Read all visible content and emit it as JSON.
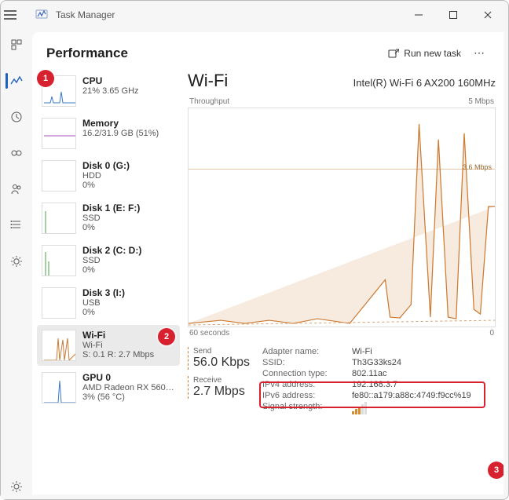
{
  "app": {
    "title": "Task Manager"
  },
  "header": {
    "pageTitle": "Performance",
    "runTask": "Run new task"
  },
  "sidebar": {
    "items": [
      {
        "title": "CPU",
        "line1": "21%  3.65 GHz",
        "line2": ""
      },
      {
        "title": "Memory",
        "line1": "16.2/31.9 GB (51%)",
        "line2": ""
      },
      {
        "title": "Disk 0 (G:)",
        "line1": "HDD",
        "line2": "0%"
      },
      {
        "title": "Disk 1 (E: F:)",
        "line1": "SSD",
        "line2": "0%"
      },
      {
        "title": "Disk 2 (C: D:)",
        "line1": "SSD",
        "line2": "0%"
      },
      {
        "title": "Disk 3 (I:)",
        "line1": "USB",
        "line2": "0%"
      },
      {
        "title": "Wi-Fi",
        "line1": "Wi-Fi",
        "line2": "S: 0.1 R: 2.7 Mbps"
      },
      {
        "title": "GPU 0",
        "line1": "AMD Radeon RX 560…",
        "line2": "3% (56 °C)"
      }
    ]
  },
  "detail": {
    "name": "Wi-Fi",
    "adapter": "Intel(R) Wi-Fi 6 AX200 160MHz",
    "throughputLabel": "Throughput",
    "maxLabel": "5 Mbps",
    "markerLabel": "3.6 Mbps",
    "xLeft": "60 seconds",
    "xRight": "0",
    "sendLabel": "Send",
    "sendVal": "56.0 Kbps",
    "recvLabel": "Receive",
    "recvVal": "2.7 Mbps",
    "props": {
      "adapterNameK": "Adapter name:",
      "adapterNameV": "Wi-Fi",
      "ssidK": "SSID:",
      "ssidV": "Th3G33ks24",
      "connTypeK": "Connection type:",
      "connTypeV": "802.11ac",
      "ipv4K": "IPv4 address:",
      "ipv4V": "192.168.3.7",
      "ipv6K": "IPv6 address:",
      "ipv6V": "fe80::a179:a88c:4749:f9cc%19",
      "sigK": "Signal strength:"
    }
  },
  "annotations": {
    "b1": "1",
    "b2": "2",
    "b3": "3"
  },
  "chart_data": {
    "type": "line",
    "title": "Throughput",
    "xlabel": "60 seconds → 0",
    "ylabel": "Throughput",
    "ylim": [
      0,
      5
    ],
    "x": [
      60,
      55,
      50,
      45,
      40,
      35,
      30,
      25,
      20,
      15,
      12,
      10,
      8,
      7,
      6,
      5,
      4,
      3,
      2,
      1,
      0
    ],
    "series": [
      {
        "name": "Send (Mbps)",
        "values": [
          0.02,
          0.02,
          0.01,
          0.02,
          0.02,
          0.03,
          0.02,
          0.02,
          0.1,
          0.05,
          0.05,
          0.07,
          0.1,
          0.1,
          0.08,
          0.1,
          0.1,
          0.08,
          0.1,
          0.1,
          0.1
        ]
      },
      {
        "name": "Receive (Mbps)",
        "values": [
          0.05,
          0.1,
          0.05,
          0.08,
          0.05,
          0.1,
          0.05,
          0.1,
          1.0,
          0.18,
          0.1,
          0.4,
          4.6,
          0.2,
          4.2,
          0.2,
          0.15,
          4.4,
          0.25,
          0.2,
          2.7
        ]
      }
    ],
    "marker_line": 3.6
  }
}
